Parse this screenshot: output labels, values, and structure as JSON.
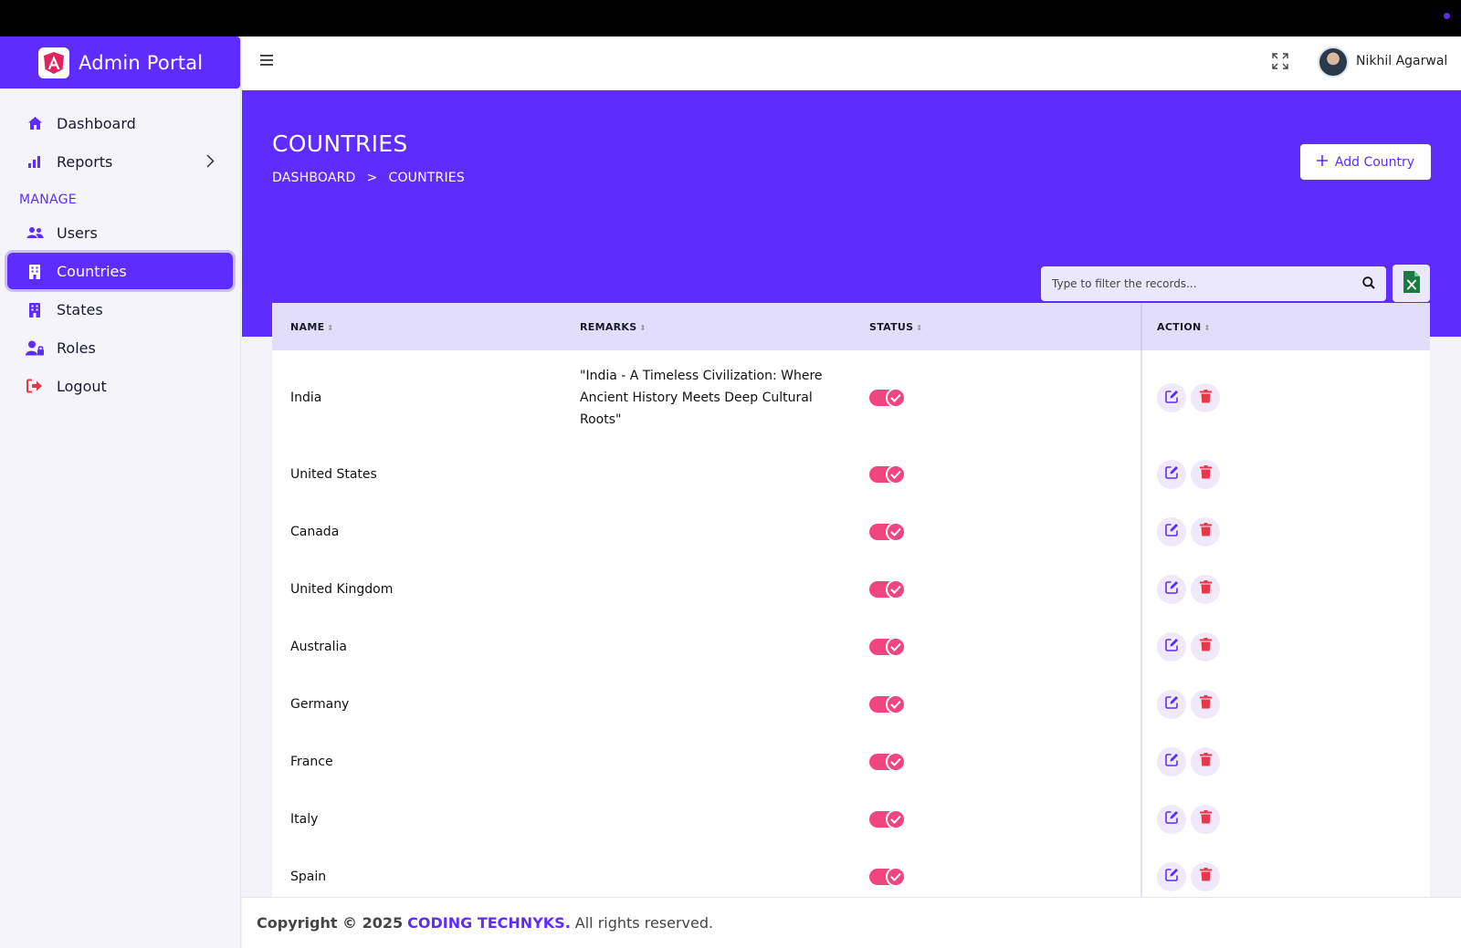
{
  "app": {
    "title": "Admin Portal"
  },
  "sidebar": {
    "items": [
      {
        "label": "Dashboard",
        "icon": "home-icon"
      },
      {
        "label": "Reports",
        "icon": "bar-chart-icon"
      }
    ],
    "section_label": "MANAGE",
    "manage_items": [
      {
        "label": "Users",
        "icon": "users-icon"
      },
      {
        "label": "Countries",
        "icon": "building-icon",
        "active": true
      },
      {
        "label": "States",
        "icon": "building-icon"
      },
      {
        "label": "Roles",
        "icon": "user-lock-icon"
      },
      {
        "label": "Logout",
        "icon": "logout-icon"
      }
    ]
  },
  "header": {
    "username": "Nikhil Agarwal"
  },
  "page": {
    "title": "COUNTRIES",
    "breadcrumb": [
      "DASHBOARD",
      ">",
      "COUNTRIES"
    ],
    "add_button_label": "Add Country",
    "search_placeholder": "Type to filter the records..."
  },
  "table": {
    "columns": [
      "NAME",
      "REMARKS",
      "STATUS",
      "ACTION"
    ],
    "rows": [
      {
        "name": "India",
        "remarks": "\"India - A Timeless Civilization: Where Ancient History Meets Deep Cultural Roots\"",
        "status": true
      },
      {
        "name": "United States",
        "remarks": "",
        "status": true
      },
      {
        "name": "Canada",
        "remarks": "",
        "status": true
      },
      {
        "name": "United Kingdom",
        "remarks": "",
        "status": true
      },
      {
        "name": "Australia",
        "remarks": "",
        "status": true
      },
      {
        "name": "Germany",
        "remarks": "",
        "status": true
      },
      {
        "name": "France",
        "remarks": "",
        "status": true
      },
      {
        "name": "Italy",
        "remarks": "",
        "status": true
      },
      {
        "name": "Spain",
        "remarks": "",
        "status": true
      }
    ]
  },
  "footer": {
    "prefix": "Copyright © 2025",
    "brand": "CODING TECHNYKS.",
    "suffix": "All rights reserved."
  },
  "colors": {
    "accent": "#5f2cff",
    "toggle_on": "#f0457f",
    "delete": "#e5394b",
    "excel": "#1e7a45"
  }
}
